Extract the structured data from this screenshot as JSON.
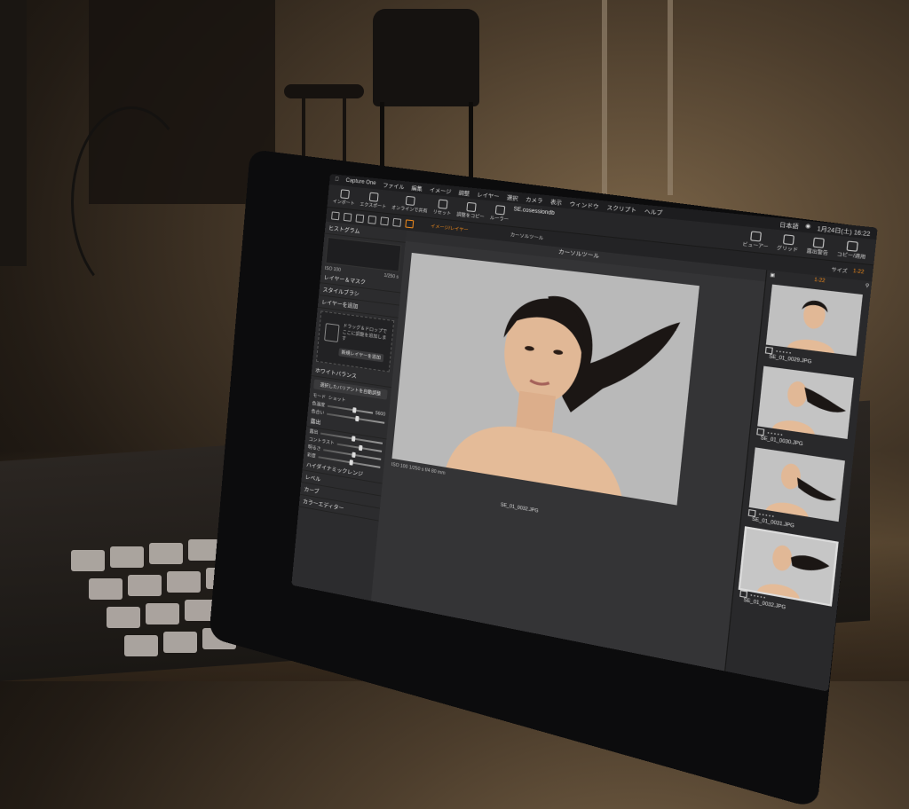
{
  "menubar": {
    "app": "Capture One",
    "items": [
      "ファイル",
      "編集",
      "イメージ",
      "調整",
      "レイヤー",
      "選択",
      "カメラ",
      "表示",
      "ウィンドウ",
      "スクリプト",
      "ヘルプ"
    ],
    "input": "日本語",
    "date": "1月24日(土) 16:22"
  },
  "toolbar": {
    "import": "インポート",
    "export": "エクスポート",
    "filename": "SE.cosessiondb",
    "online": "オンラインで共有",
    "tools": [
      "ライブラリ",
      "撮影",
      "レンズ",
      "カラー",
      "露出",
      "スタイル",
      "調整"
    ],
    "adjust": "調整",
    "reset": "リセット",
    "copy": "調整をコピー",
    "apply": "ルーラー",
    "view_viewer": "ビューアー",
    "view_grid": "グリッド",
    "view_exposure": "露出警告",
    "copy_apply": "コピー/適用"
  },
  "subbar": {
    "image_layer": "イメージ/レイヤー",
    "cursor_tool": "カーソルツール",
    "size_label": "サイズ",
    "count": "1-22"
  },
  "left_panel": {
    "histogram": "ヒストグラム",
    "iso": "ISO 100",
    "shutter": "1/250 s",
    "layers": "レイヤー＆マスク",
    "style_brush": "スタイルブラシ",
    "background": "レイヤーを追加",
    "drop_hint": "ドラッグ＆ドロップでここに調整を追加します",
    "layer_button": "新規レイヤーを追加",
    "white_balance": "ホワイトバランス",
    "wb_button": "選択したバリアントを自動調整",
    "mode_label": "モード",
    "mode_value": "ショット",
    "color_label": "色温度",
    "color_value": "5600",
    "tint_label": "色合い",
    "exposure": "露出",
    "exposure_label": "露出",
    "contrast": "コントラスト",
    "brightness": "明るさ",
    "saturation": "彩度",
    "hdr": "ハイダイナミックレンジ",
    "levels": "レベル",
    "curve": "カーブ",
    "color_editor": "カラーエディター"
  },
  "viewer": {
    "title": "カーソルツール",
    "info": "ISO 100   1/250 s   f/4   80 mm",
    "file": "SE_01_0032.JPG"
  },
  "browser": {
    "count": "1-22",
    "thumbs": [
      {
        "name": "SE_01_0029.JPG"
      },
      {
        "name": "SE_01_0030.JPG"
      },
      {
        "name": "SE_01_0031.JPG"
      },
      {
        "name": "SE_01_0032.JPG"
      }
    ]
  }
}
